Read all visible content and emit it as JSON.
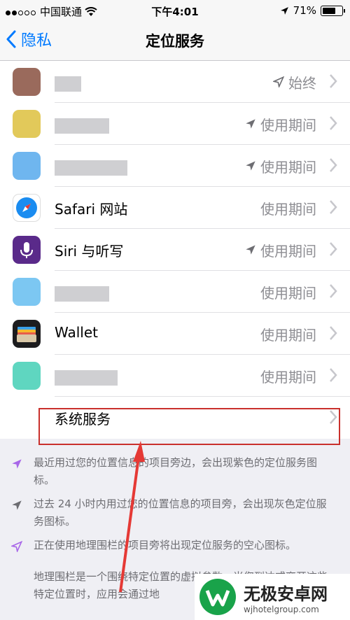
{
  "status": {
    "carrier": "中国联通",
    "time": "下午4:01",
    "battery": "71%",
    "battery_level": 0.71
  },
  "nav": {
    "back_label": "隐私",
    "title": "定位服务"
  },
  "apps": [
    {
      "name": "",
      "value": "始终",
      "arrow": "gray-outline",
      "icon_color": "#9a6a5c",
      "blur_w": 38
    },
    {
      "name": "",
      "value": "使用期间",
      "arrow": "gray",
      "icon_color": "#e2c95a",
      "blur_w": 78
    },
    {
      "name": "",
      "value": "使用期间",
      "arrow": "gray",
      "icon_color": "#6fb6ef",
      "blur_w": 104
    },
    {
      "name": "Safari 网站",
      "value": "使用期间",
      "arrow": "",
      "icon_color": "#1a8cf0",
      "blur_w": 0
    },
    {
      "name": "Siri 与听写",
      "value": "使用期间",
      "arrow": "gray",
      "icon_color": "#5a2a8a",
      "blur_w": 0
    },
    {
      "name": "",
      "value": "使用期间",
      "arrow": "",
      "icon_color": "#7cc7f2",
      "blur_w": 78
    },
    {
      "name": "Wallet",
      "value": "使用期间",
      "arrow": "",
      "icon_color": "#1c1c1e",
      "blur_w": 0
    },
    {
      "name": "",
      "value": "使用期间",
      "arrow": "",
      "icon_color": "#5fd6c0",
      "blur_w": 90
    }
  ],
  "system_services": {
    "label": "系统服务"
  },
  "footer": {
    "purple_note": "最近用过您的位置信息的项目旁边，会出现紫色的定位服务图标。",
    "gray_note": "过去 24 小时内用过您的位置信息的项目旁，会出现灰色定位服务图标。",
    "outline_note": "正在使用地理围栏的项目旁将出现定位服务的空心图标。",
    "geofence_text": "地理围栏是一个围绕特定位置的虚拟参数。当您到达或离开这些特定位置时，应用会通过地"
  },
  "watermark": {
    "brand": "无极安卓网",
    "url": "wjhotelgroup.com"
  },
  "colors": {
    "accent": "#007aff",
    "purple": "#a867e8",
    "gray_arrow": "#8e8e93",
    "highlight": "#c9302c"
  }
}
